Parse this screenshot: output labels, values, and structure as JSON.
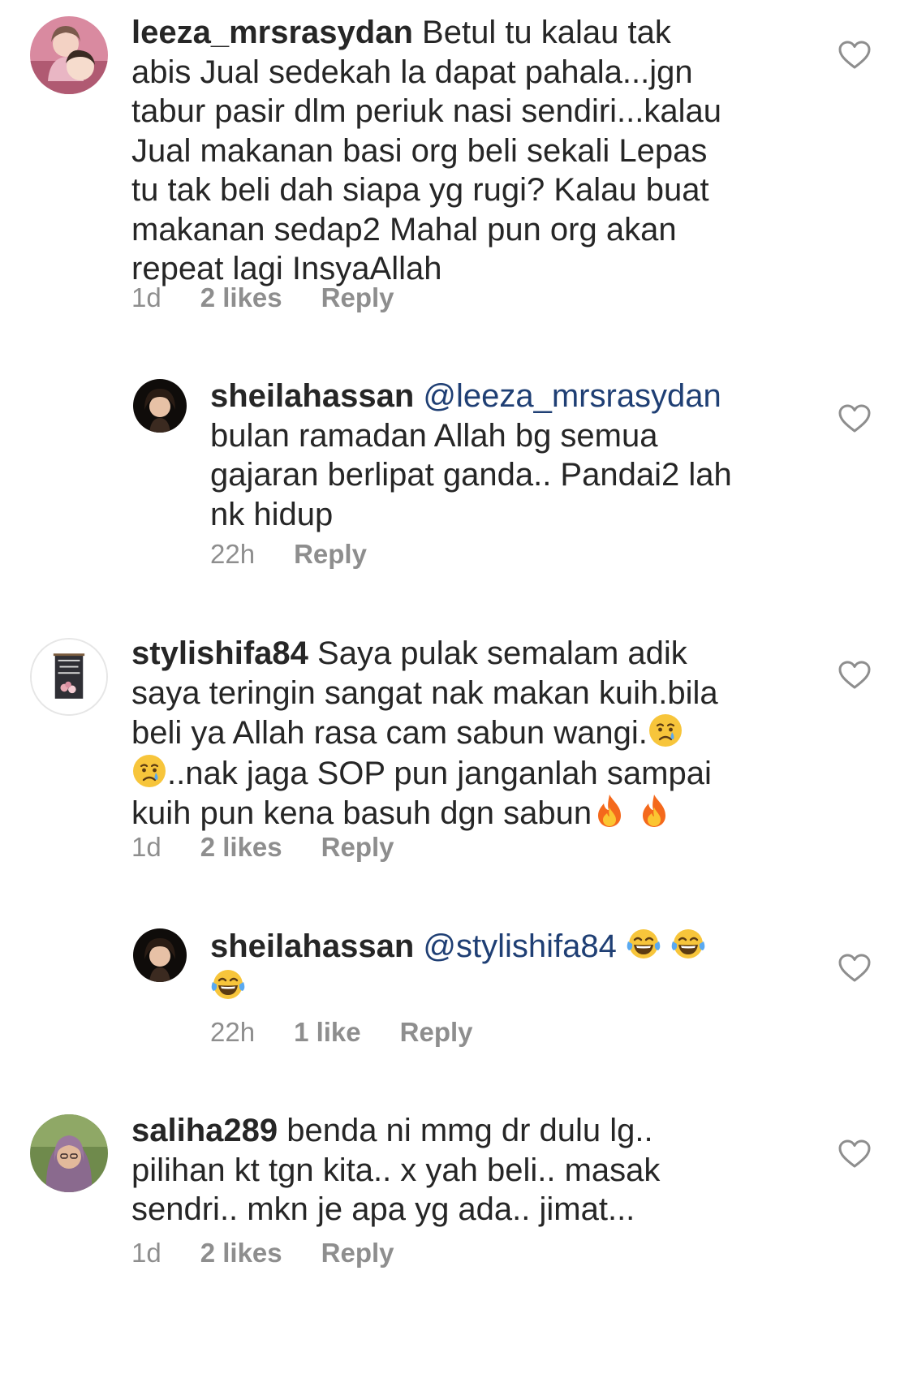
{
  "comments": [
    {
      "username": "leeza_mrsrasydan",
      "text": "Betul tu kalau tak\nabis Jual sedekah la dapat pahala...jgn\ntabur pasir dlm periuk nasi sendiri...kalau\nJual makanan basi org beli sekali Lepas\ntu tak beli dah siapa yg rugi? Kalau buat\nmakanan sedap2 Mahal pun org akan\nrepeat lagi InsyaAllah",
      "time": "1d",
      "likes": "2 likes",
      "reply_label": "Reply"
    },
    {
      "username": "sheilahassan",
      "mention": "@leeza_mrsrasydan",
      "text": "bulan ramadan Allah bg semua\ngajaran berlipat ganda.. Pandai2 lah\nnk hidup",
      "time": "22h",
      "reply_label": "Reply"
    },
    {
      "username": "stylishifa84",
      "text_1": "Saya pulak semalam adik\nsaya teringin sangat nak makan kuih.bila\nbeli ya Allah rasa cam sabun wangi.",
      "text_2": "..nak jaga SOP pun janganlah sampai\nkuih pun kena basuh dgn sabun",
      "time": "1d",
      "likes": "2 likes",
      "reply_label": "Reply"
    },
    {
      "username": "sheilahassan",
      "mention": "@stylishifa84",
      "time": "22h",
      "likes": "1 like",
      "reply_label": "Reply"
    },
    {
      "username": "saliha289",
      "text": "benda ni mmg dr dulu lg..\npilihan kt tgn kita.. x yah  beli.. masak\nsendri.. mkn je apa yg ada.. jimat...",
      "time": "1d",
      "likes": "2 likes",
      "reply_label": "Reply"
    }
  ],
  "icons": {
    "like": "heart-outline-icon",
    "crying": "crying-face-emoji",
    "fire": "fire-emoji",
    "laughing": "tears-of-joy-emoji"
  },
  "colors": {
    "text": "#262626",
    "meta": "#8e8e8e",
    "mention": "#1f3f74"
  }
}
